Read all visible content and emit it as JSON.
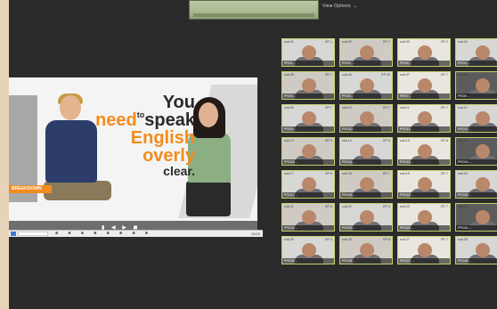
{
  "meeting": {
    "view_options_label": "View Options",
    "view_options_caret": "⌄"
  },
  "presenter": {
    "slide_lines": {
      "line1_a": "You",
      "line1_b": "need",
      "line1_small": "to",
      "line1_c": "speak",
      "line2": "English",
      "line3": "overly",
      "line4": "clear."
    },
    "brand_tag": "BREAKDOWN",
    "controls_glyphs": "▮ ◀ ▶ ◼"
  },
  "gallery": {
    "tiles": [
      {
        "header": "sub-01",
        "tag": "EP-1",
        "name": "PRO1 ..."
      },
      {
        "header": "sub-02",
        "tag": "EP-7",
        "name": "PRO2 ..."
      },
      {
        "header": "sub-03",
        "tag": "EP-7",
        "name": "PRO3 ..."
      },
      {
        "header": "sub-04",
        "tag": "EP-2",
        "name": "PRO4 ..."
      },
      {
        "header": "sub-05",
        "tag": "EP-7",
        "name": "PRO5 ..."
      },
      {
        "header": "sub-06",
        "tag": "EP-10",
        "name": "PRO6 ..."
      },
      {
        "header": "sub-07",
        "tag": "EP-7",
        "name": "PRO7 ..."
      },
      {
        "header": "sub-08",
        "tag": "EP-2",
        "name": "PRO8 ..."
      },
      {
        "header": "sub-09",
        "tag": "EP-7",
        "name": "PRO9 ..."
      },
      {
        "header": "sub-10",
        "tag": "EP-7",
        "name": "PRO10 ..."
      },
      {
        "header": "sub-11",
        "tag": "EP-7",
        "name": "PRO11 ..."
      },
      {
        "header": "sub-12",
        "tag": "EP-2",
        "name": "PRO12 ..."
      },
      {
        "header": "sub-13",
        "tag": "EP-3",
        "name": "PRO13 ..."
      },
      {
        "header": "sub-14",
        "tag": "EP-6",
        "name": "PRO14 ..."
      },
      {
        "header": "sub-15",
        "tag": "EP-8",
        "name": "PRO15 ..."
      },
      {
        "header": "sub-16",
        "tag": "EP-7",
        "name": "PRO16 ..."
      },
      {
        "header": "sub-17",
        "tag": "EP-6",
        "name": "PRO17 ..."
      },
      {
        "header": "sub-18",
        "tag": "EP-7",
        "name": "PRO18 ..."
      },
      {
        "header": "sub-19",
        "tag": "EP-7",
        "name": "PRO19 ..."
      },
      {
        "header": "sub-20",
        "tag": "EP-7",
        "name": "PRO20 ..."
      },
      {
        "header": "sub-21",
        "tag": "EP-3",
        "name": "PRO21 ..."
      },
      {
        "header": "sub-22",
        "tag": "EP-3",
        "name": "PRO22 ..."
      },
      {
        "header": "sub-23",
        "tag": "EP-7",
        "name": "PRO23 ..."
      },
      {
        "header": "sub-24",
        "tag": "EP-3",
        "name": "PRO24 ..."
      },
      {
        "header": "sub-25",
        "tag": "EP-4",
        "name": "PRO25 ..."
      },
      {
        "header": "sub-26",
        "tag": "EP-8",
        "name": "PRO26 ..."
      },
      {
        "header": "sub-27",
        "tag": "EP-7",
        "name": "PRO27 ..."
      },
      {
        "header": "sub-28",
        "tag": "EP-4",
        "name": "PRO28 ..."
      }
    ]
  },
  "taskbar": {
    "icons": "■ ■ ■ ■ ■ ■ ■ ■",
    "clock": "10:00"
  },
  "colors": {
    "background": "#2b2b2b",
    "accent_orange": "#f28c1e",
    "tile_border": "#c8cf6a"
  }
}
